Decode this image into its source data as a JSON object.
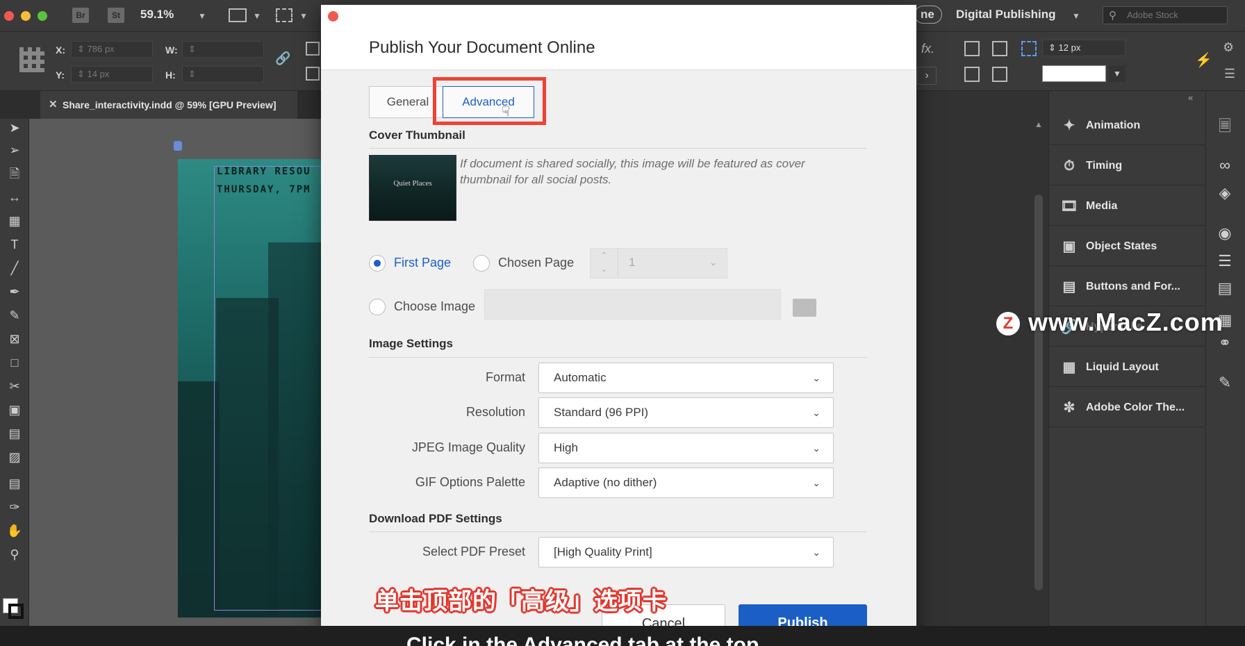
{
  "app": {
    "bridge_label": "Br",
    "stock_label": "St",
    "zoom": "59.1%",
    "workspace": "Digital Publishing",
    "workspace_prefix": "ne",
    "stock_search_placeholder": "Adobe Stock"
  },
  "controlbar": {
    "x_label": "X:",
    "x_value": "786 px",
    "y_label": "Y:",
    "y_value": "14 px",
    "w_label": "W:",
    "h_label": "H:",
    "stroke_value": "12 px",
    "fx_label": "fx."
  },
  "document_tab": {
    "title": "Share_interactivity.indd @ 59% [GPU Preview]"
  },
  "page_preview": {
    "line1": "LIBRARY RESOU",
    "line2": "THURSDAY, 7PM"
  },
  "panels": [
    {
      "label": "Animation",
      "icon": "animation-icon"
    },
    {
      "label": "Timing",
      "icon": "timing-icon"
    },
    {
      "label": "Media",
      "icon": "media-icon"
    },
    {
      "label": "Object States",
      "icon": "object-states-icon"
    },
    {
      "label": "Buttons and For...",
      "icon": "buttons-forms-icon"
    },
    {
      "label": "Hyperlinks",
      "icon": "hyperlinks-icon"
    },
    {
      "label": "Liquid Layout",
      "icon": "liquid-layout-icon"
    },
    {
      "label": "Adobe Color The...",
      "icon": "color-themes-icon"
    }
  ],
  "dialog": {
    "title": "Publish Your Document Online",
    "tabs": {
      "general": "General",
      "advanced": "Advanced"
    },
    "cover_thumbnail": {
      "title": "Cover Thumbnail",
      "thumb_text": "Quiet Places",
      "note": "If document is shared socially, this image will be featured as cover thumbnail for all social posts.",
      "first_page": "First Page",
      "chosen_page": "Chosen Page",
      "chosen_page_value": "1",
      "choose_image": "Choose Image"
    },
    "image_settings": {
      "title": "Image Settings",
      "rows": [
        {
          "label": "Format",
          "value": "Automatic"
        },
        {
          "label": "Resolution",
          "value": "Standard (96 PPI)"
        },
        {
          "label": "JPEG Image Quality",
          "value": "High"
        },
        {
          "label": "GIF Options Palette",
          "value": "Adaptive (no dither)"
        }
      ]
    },
    "pdf_settings": {
      "title": "Download PDF Settings",
      "preset_label": "Select PDF Preset",
      "preset_value": "[High Quality Print]"
    },
    "buttons": {
      "cancel": "Cancel",
      "publish": "Publish"
    }
  },
  "overlay": {
    "watermark": "www.MacZ.com",
    "watermark_logo": "Z",
    "subtitle_cn": "单击顶部的「高级」选项卡",
    "subtitle_en": "Click in the Advanced tab at the top"
  }
}
